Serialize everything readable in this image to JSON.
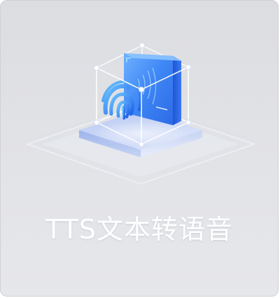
{
  "card": {
    "title": "TTS文本转语音",
    "illustration_icon": "tts-fingerprint-cube-icon"
  },
  "colors": {
    "card_background": "#dfe0e4",
    "card_border": "#cfd1d6",
    "title_text": "#ffffff",
    "accent_blue": "#2f7cf6",
    "platform_blue": "#7e9fe3"
  }
}
